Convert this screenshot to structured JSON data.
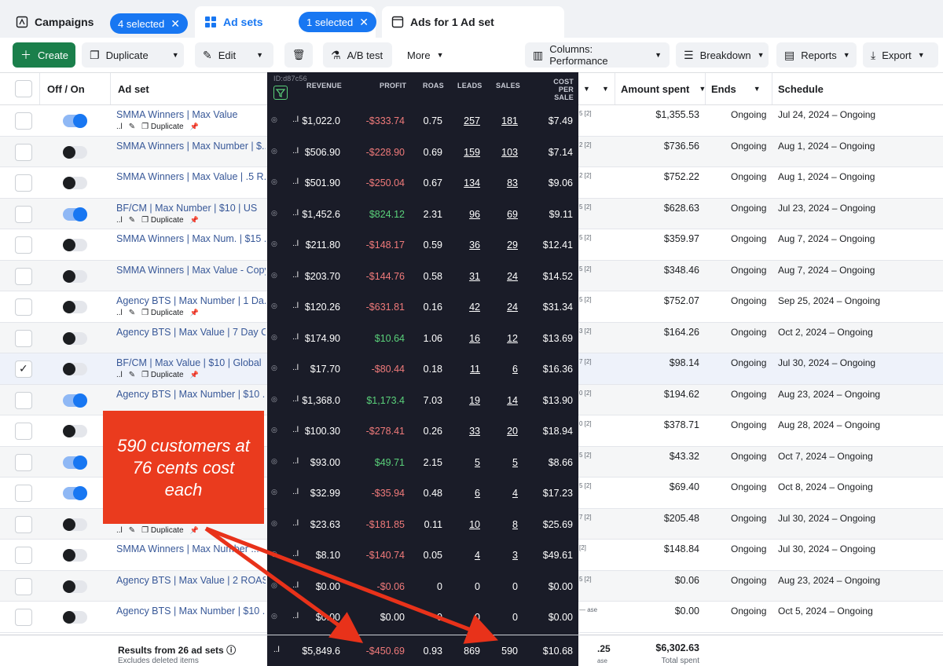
{
  "tabs": {
    "campaigns": "Campaigns",
    "campaigns_selected": "4 selected",
    "adsets": "Ad sets",
    "adsets_selected": "1 selected",
    "ads": "Ads for 1 Ad set"
  },
  "toolbar": {
    "create": "Create",
    "duplicate": "Duplicate",
    "edit": "Edit",
    "ab_test": "A/B test",
    "more": "More",
    "columns": "Columns: Performance",
    "breakdown": "Breakdown",
    "reports": "Reports",
    "export": "Export"
  },
  "header": {
    "off_on": "Off / On",
    "ad_set": "Ad set",
    "id_label": "ID:d87c56",
    "revenue": "REVENUE",
    "profit": "PROFIT",
    "roas": "ROAS",
    "leads": "LEADS",
    "sales": "SALES",
    "cost_per_sale_1": "COST PER",
    "cost_per_sale_2": "SALE",
    "amount_spent": "Amount spent",
    "ends": "Ends",
    "schedule": "Schedule"
  },
  "row_actions": {
    "duplicate": "Duplicate"
  },
  "rows": [
    {
      "name": "SMMA Winners | Max Value",
      "on": true,
      "checked": false,
      "sub": true,
      "revenue": "$1,022.0",
      "profit": "-$333.74",
      "profit_sign": "neg",
      "roas": "0.75",
      "leads": "257",
      "sales": "181",
      "cps": "$7.49",
      "mini": "5 [2]",
      "spent": "$1,355.53",
      "ends": "Ongoing",
      "schedule": "Jul 24, 2024 – Ongoing"
    },
    {
      "name": "SMMA Winners | Max Number | $...",
      "on": false,
      "checked": false,
      "sub": false,
      "revenue": "$506.90",
      "profit": "-$228.90",
      "profit_sign": "neg",
      "roas": "0.69",
      "leads": "159",
      "sales": "103",
      "cps": "$7.14",
      "mini": "2 [2]",
      "spent": "$736.56",
      "ends": "Ongoing",
      "schedule": "Aug 1, 2024 – Ongoing"
    },
    {
      "name": "SMMA Winners | Max Value | .5 R...",
      "on": false,
      "checked": false,
      "sub": false,
      "revenue": "$501.90",
      "profit": "-$250.04",
      "profit_sign": "neg",
      "roas": "0.67",
      "leads": "134",
      "sales": "83",
      "cps": "$9.06",
      "mini": "2 [2]",
      "spent": "$752.22",
      "ends": "Ongoing",
      "schedule": "Aug 1, 2024 – Ongoing"
    },
    {
      "name": "BF/CM | Max Number | $10 | US",
      "on": true,
      "checked": false,
      "sub": true,
      "revenue": "$1,452.6",
      "profit": "$824.12",
      "profit_sign": "pos",
      "roas": "2.31",
      "leads": "96",
      "sales": "69",
      "cps": "$9.11",
      "mini": "5 [2]",
      "spent": "$628.63",
      "ends": "Ongoing",
      "schedule": "Jul 23, 2024 – Ongoing"
    },
    {
      "name": "SMMA Winners | Max Num. | $15 ...",
      "on": false,
      "checked": false,
      "sub": false,
      "revenue": "$211.80",
      "profit": "-$148.17",
      "profit_sign": "neg",
      "roas": "0.59",
      "leads": "36",
      "sales": "29",
      "cps": "$12.41",
      "mini": "5 [2]",
      "spent": "$359.97",
      "ends": "Ongoing",
      "schedule": "Aug 7, 2024 – Ongoing"
    },
    {
      "name": "SMMA Winners | Max Value - Copy",
      "on": false,
      "checked": false,
      "sub": false,
      "revenue": "$203.70",
      "profit": "-$144.76",
      "profit_sign": "neg",
      "roas": "0.58",
      "leads": "31",
      "sales": "24",
      "cps": "$14.52",
      "mini": "5 [2]",
      "spent": "$348.46",
      "ends": "Ongoing",
      "schedule": "Aug 7, 2024 – Ongoing"
    },
    {
      "name": "Agency BTS | Max Number | 1 Da...",
      "on": false,
      "checked": false,
      "sub": true,
      "revenue": "$120.26",
      "profit": "-$631.81",
      "profit_sign": "neg",
      "roas": "0.16",
      "leads": "42",
      "sales": "24",
      "cps": "$31.34",
      "mini": "5 [2]",
      "spent": "$752.07",
      "ends": "Ongoing",
      "schedule": "Sep 25, 2024 – Ongoing"
    },
    {
      "name": "Agency BTS | Max Value | 7 Day C...",
      "on": false,
      "checked": false,
      "sub": false,
      "revenue": "$174.90",
      "profit": "$10.64",
      "profit_sign": "pos",
      "roas": "1.06",
      "leads": "16",
      "sales": "12",
      "cps": "$13.69",
      "mini": "3 [2]",
      "spent": "$164.26",
      "ends": "Ongoing",
      "schedule": "Oct 2, 2024 – Ongoing"
    },
    {
      "name": "BF/CM | Max Value | $10 | Global",
      "on": false,
      "checked": true,
      "sub": true,
      "revenue": "$17.70",
      "profit": "-$80.44",
      "profit_sign": "neg",
      "roas": "0.18",
      "leads": "11",
      "sales": "6",
      "cps": "$16.36",
      "mini": "7 [2]",
      "spent": "$98.14",
      "ends": "Ongoing",
      "schedule": "Jul 30, 2024 – Ongoing"
    },
    {
      "name": "Agency BTS | Max Number | $10 ...",
      "on": true,
      "checked": false,
      "sub": false,
      "revenue": "$1,368.0",
      "profit": "$1,173.4",
      "profit_sign": "pos",
      "roas": "7.03",
      "leads": "19",
      "sales": "14",
      "cps": "$13.90",
      "mini": "0 [2]",
      "spent": "$194.62",
      "ends": "Ongoing",
      "schedule": "Aug 23, 2024 – Ongoing"
    },
    {
      "name": "",
      "on": false,
      "checked": false,
      "sub": false,
      "revenue": "$100.30",
      "profit": "-$278.41",
      "profit_sign": "neg",
      "roas": "0.26",
      "leads": "33",
      "sales": "20",
      "cps": "$18.94",
      "mini": "0 [2]",
      "spent": "$378.71",
      "ends": "Ongoing",
      "schedule": "Aug 28, 2024 – Ongoing"
    },
    {
      "name": "",
      "on": true,
      "checked": false,
      "sub": false,
      "revenue": "$93.00",
      "profit": "$49.71",
      "profit_sign": "pos",
      "roas": "2.15",
      "leads": "5",
      "sales": "5",
      "cps": "$8.66",
      "mini": "5 [2]",
      "spent": "$43.32",
      "ends": "Ongoing",
      "schedule": "Oct 7, 2024 – Ongoing"
    },
    {
      "name": "",
      "on": true,
      "checked": false,
      "sub": false,
      "revenue": "$32.99",
      "profit": "-$35.94",
      "profit_sign": "neg",
      "roas": "0.48",
      "leads": "6",
      "sales": "4",
      "cps": "$17.23",
      "mini": "5 [2]",
      "spent": "$69.40",
      "ends": "Ongoing",
      "schedule": "Oct 8, 2024 – Ongoing"
    },
    {
      "name": "",
      "on": false,
      "checked": false,
      "sub": true,
      "revenue": "$23.63",
      "profit": "-$181.85",
      "profit_sign": "neg",
      "roas": "0.11",
      "leads": "10",
      "sales": "8",
      "cps": "$25.69",
      "mini": "7 [2]",
      "spent": "$205.48",
      "ends": "Ongoing",
      "schedule": "Jul 30, 2024 – Ongoing"
    },
    {
      "name": "SMMA Winners | Max Number ...",
      "on": false,
      "checked": false,
      "sub": false,
      "revenue": "$8.10",
      "profit": "-$140.74",
      "profit_sign": "neg",
      "roas": "0.05",
      "leads": "4",
      "sales": "3",
      "cps": "$49.61",
      "mini": "[2]",
      "spent": "$148.84",
      "ends": "Ongoing",
      "schedule": "Jul 30, 2024 – Ongoing"
    },
    {
      "name": "Agency BTS | Max Value | 2 ROAS",
      "on": false,
      "checked": false,
      "sub": false,
      "revenue": "$0.00",
      "profit": "-$0.06",
      "profit_sign": "neg",
      "roas": "0",
      "leads": "0",
      "sales": "0",
      "cps": "$0.00",
      "mini": "5 [2]",
      "spent": "$0.06",
      "ends": "Ongoing",
      "schedule": "Aug 23, 2024 – Ongoing"
    },
    {
      "name": "Agency BTS | Max Number | $10 ...",
      "on": false,
      "checked": false,
      "sub": false,
      "revenue": "$0.00",
      "profit": "$0.00",
      "profit_sign": "zero",
      "roas": "0",
      "leads": "0",
      "sales": "0",
      "cps": "$0.00",
      "mini": "— ase",
      "spent": "$0.00",
      "ends": "Ongoing",
      "schedule": "Oct 5, 2024 – Ongoing"
    }
  ],
  "totals": {
    "label": "Results from 26 ad sets",
    "sub": "Excludes deleted items",
    "revenue": "$5,849.6",
    "profit": "-$450.69",
    "roas": "0.93",
    "leads": "869",
    "sales": "590",
    "cps": "$10.68",
    "mini": ".25",
    "mini_sub": "ase",
    "spent": "$6,302.63",
    "spent_sub": "Total spent"
  },
  "callout": {
    "line1": "590 customers at",
    "line2": "76 cents cost",
    "line3": "each"
  },
  "colors": {
    "accent": "#1877f2",
    "create": "#1a7f4b",
    "dark_panel": "#1a1c28",
    "negative": "#f07a7a",
    "positive": "#5ad17a",
    "callout": "#ea3b1e"
  },
  "icons": {
    "campaigns": "campaign-icon",
    "adsets": "grid-icon",
    "ads": "ad-icon",
    "filter": "filter-icon"
  }
}
